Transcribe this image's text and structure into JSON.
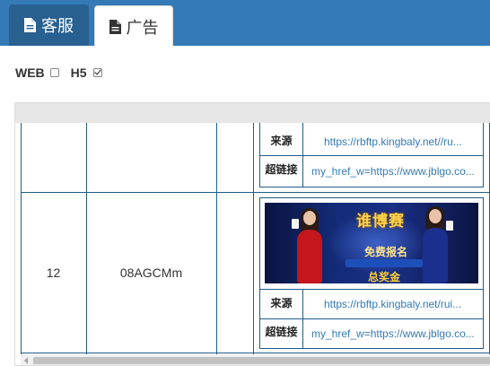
{
  "tabs": [
    {
      "label": "客服",
      "icon": "file-icon",
      "active": false
    },
    {
      "label": "广告",
      "icon": "file-icon",
      "active": true
    }
  ],
  "platform": {
    "web_label": "WEB",
    "web_checked": false,
    "h5_label": "H5",
    "h5_checked": true
  },
  "rows": [
    {
      "id": "",
      "code": "",
      "source_label": "来源",
      "source_value": "https://rbftp.kingbaly.net//ru...",
      "link_label": "超链接",
      "link_value": "my_href_w=https://www.jblgo.co..."
    },
    {
      "id": "12",
      "code": "08AGCMm",
      "banner": {
        "title": "谁博赛",
        "subtitle": "免费报名",
        "prize": "总奖金"
      },
      "source_label": "来源",
      "source_value": "https://rbftp.kingbaly.net/rui...",
      "link_label": "超链接",
      "link_value": "my_href_w=https://www.jblgo.co..."
    }
  ],
  "colors": {
    "topbar": "#337ab7",
    "active_tab_dark": "#286090",
    "link": "#337ab7",
    "grid_line": "#1f5d8a"
  }
}
